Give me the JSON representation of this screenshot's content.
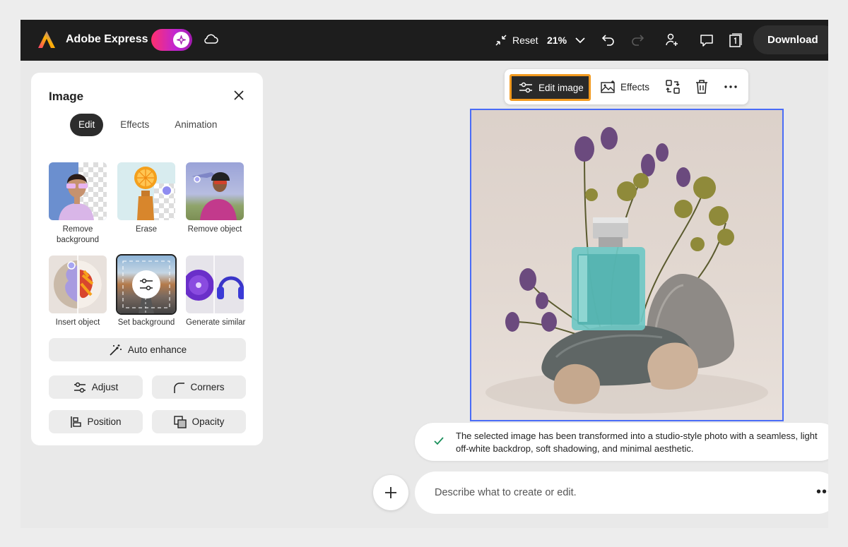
{
  "header": {
    "app_name": "Adobe Express",
    "reset_label": "Reset",
    "zoom": "21%",
    "download_label": "Download"
  },
  "panel": {
    "title": "Image",
    "tabs": [
      {
        "label": "Edit",
        "active": true
      },
      {
        "label": "Effects",
        "active": false
      },
      {
        "label": "Animation",
        "active": false
      }
    ],
    "tools": [
      {
        "label": "Remove background"
      },
      {
        "label": "Erase"
      },
      {
        "label": "Remove object"
      },
      {
        "label": "Insert object"
      },
      {
        "label": "Set background",
        "selected": true
      },
      {
        "label": "Generate similar"
      }
    ],
    "auto_enhance_label": "Auto enhance",
    "buttons": {
      "adjust": "Adjust",
      "corners": "Corners",
      "position": "Position",
      "opacity": "Opacity"
    }
  },
  "float_toolbar": {
    "edit_image_label": "Edit image",
    "effects_label": "Effects"
  },
  "message": {
    "text": "The selected image has been transformed into a studio-style photo with a seamless, light off-white backdrop, soft shadowing, and minimal aesthetic."
  },
  "prompt": {
    "placeholder": "Describe what to create or edit."
  },
  "colors": {
    "topbar": "#1d1d1d",
    "selection_outline": "#4a6cf7",
    "highlight": "#f29a1f",
    "success": "#1a8f5b"
  }
}
